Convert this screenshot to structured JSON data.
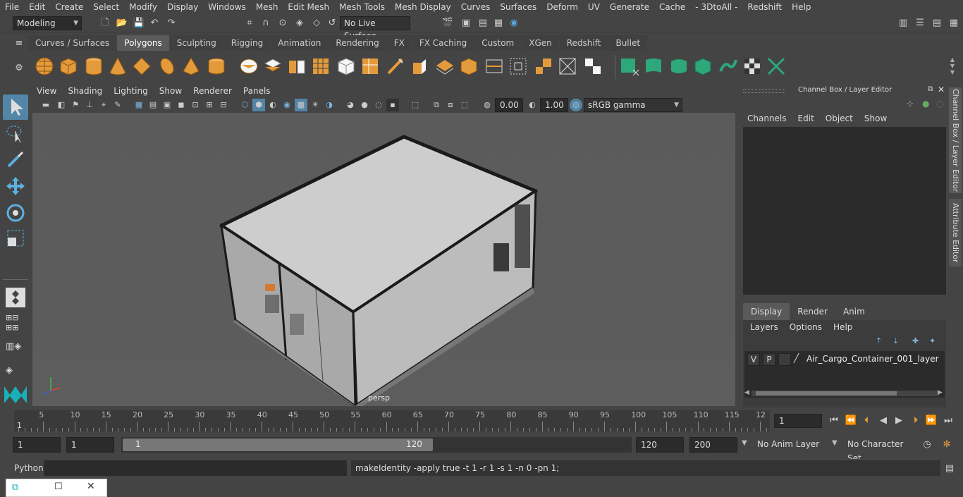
{
  "menu": [
    "File",
    "Edit",
    "Create",
    "Select",
    "Modify",
    "Display",
    "Windows",
    "Mesh",
    "Edit Mesh",
    "Mesh Tools",
    "Mesh Display",
    "Curves",
    "Surfaces",
    "Deform",
    "UV",
    "Generate",
    "Cache",
    "- 3DtoAll -",
    "Redshift",
    "Help"
  ],
  "status": {
    "mode": "Modeling",
    "live_surface": "No Live Surface"
  },
  "shelf_tabs": [
    "Curves / Surfaces",
    "Polygons",
    "Sculpting",
    "Rigging",
    "Animation",
    "Rendering",
    "FX",
    "FX Caching",
    "Custom",
    "XGen",
    "Redshift",
    "Bullet"
  ],
  "shelf_active": "Polygons",
  "viewport": {
    "menu": [
      "View",
      "Shading",
      "Lighting",
      "Show",
      "Renderer",
      "Panels"
    ],
    "exposure": "0.00",
    "gamma": "1.00",
    "color_space": "sRGB gamma",
    "camera_label": "persp"
  },
  "channel_box": {
    "title": "Channel Box / Layer Editor",
    "menu": [
      "Channels",
      "Edit",
      "Object",
      "Show"
    ],
    "tabs": [
      "Display",
      "Render",
      "Anim"
    ],
    "active_tab": "Display",
    "layer_menu": [
      "Layers",
      "Options",
      "Help"
    ],
    "layer": {
      "v": "V",
      "p": "P",
      "name": "Air_Cargo_Container_001_layer"
    }
  },
  "side_tabs": [
    "Channel Box / Layer Editor",
    "Attribute Editor"
  ],
  "timeline": {
    "ticks": [
      "5",
      "10",
      "15",
      "20",
      "25",
      "30",
      "35",
      "40",
      "45",
      "50",
      "55",
      "60",
      "65",
      "70",
      "75",
      "80",
      "85",
      "90",
      "95",
      "100",
      "105",
      "110",
      "115",
      "12"
    ],
    "first_tick": "1",
    "current_frame": "1"
  },
  "range": {
    "start": "1",
    "start2": "1",
    "slider_start": "1",
    "slider_end": "120",
    "end": "120",
    "end2": "200",
    "anim_layer": "No Anim Layer",
    "char_set": "No Character Set"
  },
  "cmd": {
    "lang": "Python",
    "output": "makeIdentity -apply true -t 1 -r 1 -s 1 -n 0 -pn 1;"
  },
  "colors": {
    "accent": "#5285a6",
    "shelf_orange": "#e39a3b",
    "shelf_green": "#2ea77a"
  }
}
